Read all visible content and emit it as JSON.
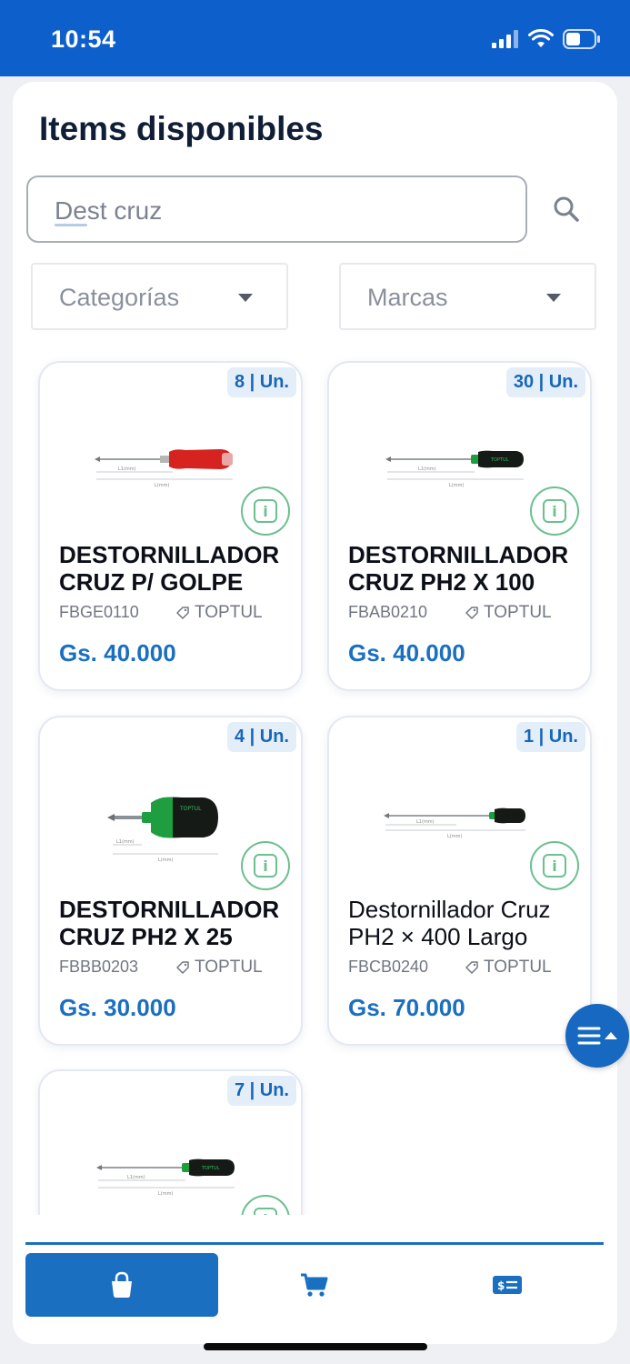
{
  "status_bar": {
    "time": "10:54"
  },
  "page": {
    "title": "Items disponibles"
  },
  "search": {
    "value": "Dest cruz"
  },
  "filters": {
    "categories_label": "Categorías",
    "brands_label": "Marcas"
  },
  "products": [
    {
      "stock": "8 | Un.",
      "name": "DESTORNILLADOR CRUZ P/ GOLPE",
      "code": "FBGE0110",
      "brand": "TOPTUL",
      "price": "Gs. 40.000",
      "handle_color": "#d7231f"
    },
    {
      "stock": "30 | Un.",
      "name": "DESTORNILLADOR CRUZ PH2 X 100",
      "code": "FBAB0210",
      "brand": "TOPTUL",
      "price": "Gs. 40.000",
      "handle_color": "#1e9e3e"
    },
    {
      "stock": "4 | Un.",
      "name": "DESTORNILLADOR CRUZ PH2 X 25",
      "code": "FBBB0203",
      "brand": "TOPTUL",
      "price": "Gs. 30.000",
      "handle_color": "#1e9e3e"
    },
    {
      "stock": "1 | Un.",
      "name": "Destornillador Cruz PH2 × 400 Largo",
      "code": "FBCB0240",
      "brand": "TOPTUL",
      "price": "Gs. 70.000",
      "handle_color": "#1e9e3e"
    },
    {
      "stock": "7 | Un.",
      "name": "",
      "code": "",
      "brand": "",
      "price": "",
      "handle_color": "#1e9e3e"
    }
  ],
  "icons": {
    "search": "search-icon",
    "info": "info-icon",
    "tag": "tag-icon",
    "menu": "menu-icon",
    "bag": "shopping-bag-icon",
    "cart": "cart-icon",
    "bill": "money-bill-icon"
  },
  "colors": {
    "brand_blue": "#1a6fc0",
    "status_bar": "#0d5fcc",
    "info_green": "#6cbf8f"
  }
}
